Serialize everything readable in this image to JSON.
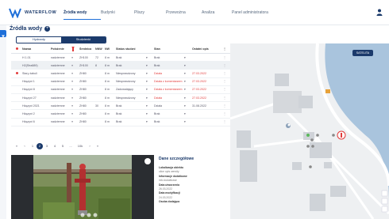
{
  "brand": {
    "name": "WATERFLOW"
  },
  "nav": {
    "items": [
      "Źródła wody",
      "Budynki",
      "Pliszy",
      "Przewożna",
      "Analiza",
      "Panel administratora"
    ]
  },
  "page": {
    "title": "Źródła wody"
  },
  "tabs": [
    "Hydranty",
    "Studzienki"
  ],
  "table": {
    "headers": [
      "Nazwa",
      "Położenie",
      "",
      "Średnica",
      "NNW",
      "NW",
      "Status studzni",
      "",
      "Stan",
      "",
      "Ostatni opis",
      ""
    ],
    "rows": [
      {
        "name": "H 1.01",
        "loc": "nadziemne",
        "diam": "ZH100",
        "nnw": "72",
        "nw": "8 m",
        "status": "Brak",
        "state": "Brak",
        "date": "",
        "red": false,
        "marker": false
      },
      {
        "name": "H2(Stra889)",
        "loc": "nadziemne",
        "diam": "ZH100",
        "nnw": "8",
        "nw": "8 m",
        "status": "Brak",
        "state": "Brak",
        "date": "",
        "red": false,
        "marker": false
      },
      {
        "name": "Stary żabuli",
        "loc": "nadziemne",
        "diam": "ZH80",
        "nnw": "",
        "nw": "8 m",
        "status": "Niesprawdzony",
        "state": "Działa",
        "date": "27.03.2022",
        "red": true,
        "marker": true
      },
      {
        "name": "Hżązyni 1",
        "loc": "nadziemne",
        "diam": "ZH80",
        "nnw": "",
        "nw": "8 m",
        "status": "Niesprawdzony",
        "state": "Działa z komentarzem",
        "date": "27.03.2022",
        "red": true,
        "marker": false
      },
      {
        "name": "Hżązyni 8",
        "loc": "nadziemne",
        "diam": "ZH80",
        "nnw": "",
        "nw": "8 m",
        "status": "Zadowalający",
        "state": "Działa z komentarzem",
        "date": "27.03.2022",
        "red": true,
        "marker": false
      },
      {
        "name": "Hżązyni 27",
        "loc": "nadziemne",
        "diam": "ZH80",
        "nnw": "",
        "nw": "8 m",
        "status": "Niesprawdzony",
        "state": "Działa",
        "date": "27.03.2022",
        "red": true,
        "marker": false
      },
      {
        "name": "Hżązyni 2021",
        "loc": "nadziemne",
        "diam": "ZH80",
        "nnw": "30",
        "nw": "8 m",
        "status": "Brak",
        "state": "Działa",
        "date": "31.08.2022",
        "red": false,
        "marker": false
      },
      {
        "name": "Hżązyni 2",
        "loc": "nadziemne",
        "diam": "ZH80",
        "nnw": "",
        "nw": "8 m",
        "status": "Brak",
        "state": "Brak",
        "date": "",
        "red": false,
        "marker": false
      },
      {
        "name": "Hżązyni 6",
        "loc": "nadziemne",
        "diam": "ZH80",
        "nnw": "",
        "nw": "8 m",
        "status": "Brak",
        "state": "Brak",
        "date": "",
        "red": false,
        "marker": false
      }
    ]
  },
  "pagination": {
    "pages": [
      "«",
      "‹",
      "1",
      "2",
      "3",
      "4",
      "5",
      "...",
      "10k",
      "›",
      "»"
    ],
    "current": "2"
  },
  "details": {
    "title": "Dane szczegółowe",
    "lines": [
      {
        "label": "Lokalizacja obiektu",
        "value": "ulice opis wersity"
      },
      {
        "label": "Informacje dodatkowe",
        "value": "info dodatkowe"
      },
      {
        "label": "Data utworzenia",
        "value": "26.03.2022"
      },
      {
        "label": "Data modyfikacji",
        "value": "24.03.2022"
      },
      {
        "label": "Osoba dodająca",
        "value": ""
      }
    ]
  },
  "map": {
    "button": "SATELITA"
  },
  "colors": {
    "accent": "#1b3a6b",
    "primary_blue": "#1e6fd9",
    "alert": "#e23b3b"
  }
}
